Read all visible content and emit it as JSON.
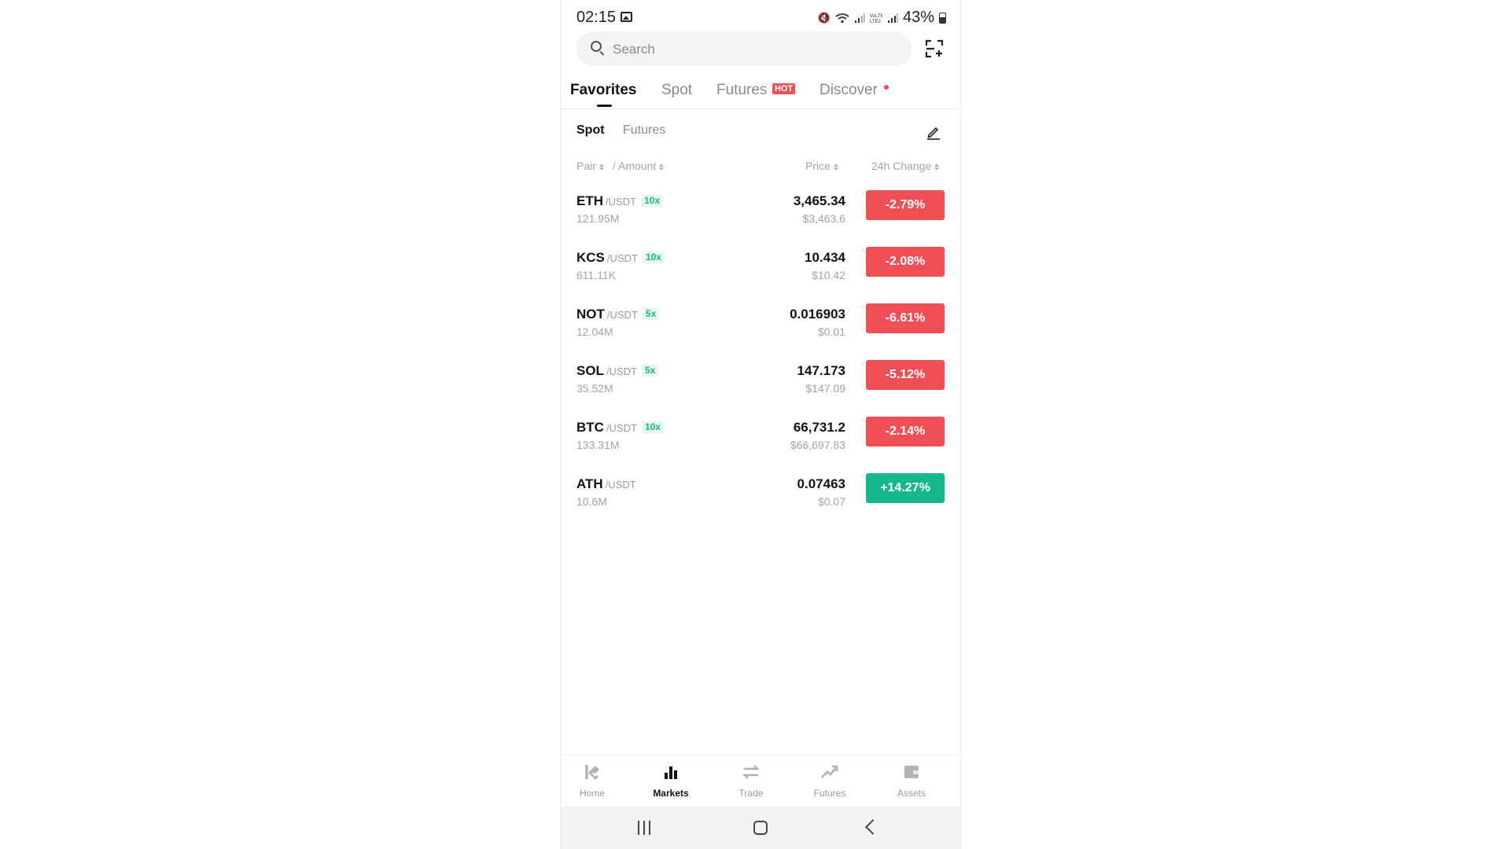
{
  "status_bar": {
    "time": "02:15",
    "battery": "43%",
    "icons": [
      "image-icon",
      "mute-icon",
      "wifi-icon",
      "signal-icon",
      "volte-icon",
      "battery-icon"
    ]
  },
  "search": {
    "placeholder": "Search",
    "value": ""
  },
  "tabs": [
    {
      "label": "Favorites",
      "active": true
    },
    {
      "label": "Spot"
    },
    {
      "label": "Futures",
      "badge": "HOT"
    },
    {
      "label": "Discover",
      "dot": true
    }
  ],
  "subtabs": [
    {
      "label": "Spot",
      "active": true
    },
    {
      "label": "Futures"
    }
  ],
  "columns": {
    "pair": "Pair",
    "amount": "/ Amount",
    "price": "Price",
    "change": "24h Change"
  },
  "rows": [
    {
      "base": "ETH",
      "quote": "/USDT",
      "leverage": "10x",
      "amount": "121.95M",
      "price": "3,465.34",
      "fiat": "$3,463.6",
      "change": "-2.79%",
      "direction": "down"
    },
    {
      "base": "KCS",
      "quote": "/USDT",
      "leverage": "10x",
      "amount": "611.11K",
      "price": "10.434",
      "fiat": "$10.42",
      "change": "-2.08%",
      "direction": "down"
    },
    {
      "base": "NOT",
      "quote": "/USDT",
      "leverage": "5x",
      "amount": "12.04M",
      "price": "0.016903",
      "fiat": "$0.01",
      "change": "-6.61%",
      "direction": "down"
    },
    {
      "base": "SOL",
      "quote": "/USDT",
      "leverage": "5x",
      "amount": "35.52M",
      "price": "147.173",
      "fiat": "$147.09",
      "change": "-5.12%",
      "direction": "down"
    },
    {
      "base": "BTC",
      "quote": "/USDT",
      "leverage": "10x",
      "amount": "133.31M",
      "price": "66,731.2",
      "fiat": "$66,697.83",
      "change": "-2.14%",
      "direction": "down"
    },
    {
      "base": "ATH",
      "quote": "/USDT",
      "leverage": "",
      "amount": "10.6M",
      "price": "0.07463",
      "fiat": "$0.07",
      "change": "+14.27%",
      "direction": "up"
    }
  ],
  "bottom_nav": [
    {
      "label": "Home",
      "icon": "home-icon"
    },
    {
      "label": "Markets",
      "icon": "markets-icon",
      "active": true
    },
    {
      "label": "Trade",
      "icon": "trade-icon"
    },
    {
      "label": "Futures",
      "icon": "futures-icon"
    },
    {
      "label": "Assets",
      "icon": "assets-icon"
    }
  ],
  "colors": {
    "down": "#ef4f55",
    "up": "#14b889",
    "badge_hot": "#ef4f55"
  }
}
